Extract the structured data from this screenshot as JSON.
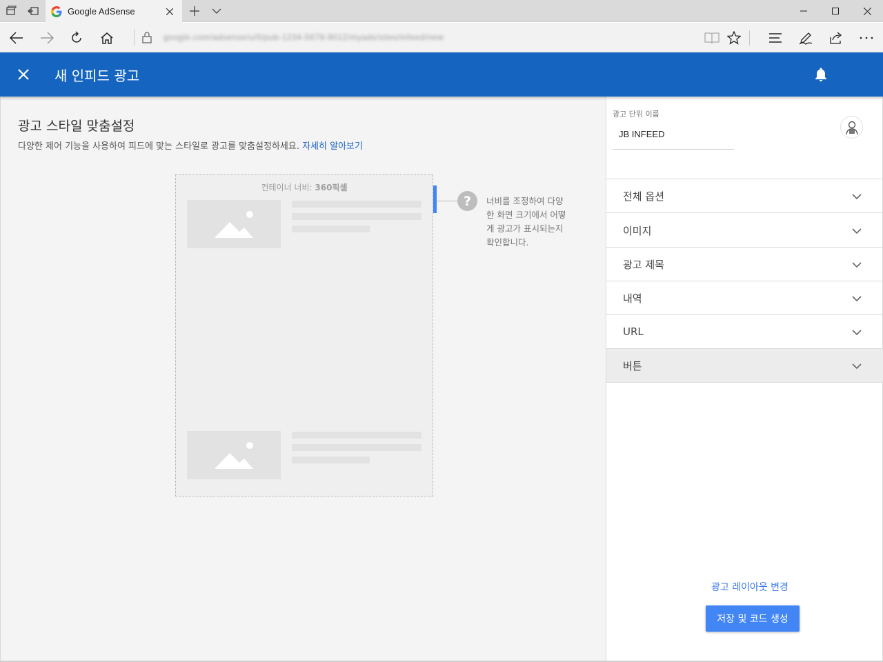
{
  "browser": {
    "tab_title": "Google AdSense",
    "url": "google.com/adsense/u/0/pub-1234-5678-9012/myads/sites/infeed/new"
  },
  "header": {
    "title": "새 인피드 광고"
  },
  "main": {
    "title": "광고 스타일 맞춤설정",
    "subtitle": "다양한 제어 기능을 사용하여 피드에 맞는 스타일로 광고를 맞춤설정하세요.",
    "learn_more": "자세히 알아보기",
    "container_width_label": "컨테이너 너비:",
    "container_width_value": "360픽셀",
    "help_icon_glyph": "?",
    "hint_text": "너비를 조정하여 다양한 화면 크기에서 어떻게 광고가 표시되는지 확인합니다."
  },
  "side": {
    "ad_unit_name_label": "광고 단위 이름",
    "ad_unit_name_value": "JB INFEED",
    "sections": [
      {
        "label": "전체 옵션"
      },
      {
        "label": "이미지"
      },
      {
        "label": "광고 제목"
      },
      {
        "label": "내역"
      },
      {
        "label": "URL"
      },
      {
        "label": "버튼"
      }
    ],
    "change_layout": "광고 레이아웃 변경",
    "save_button": "저장 및 코드 생성"
  },
  "colors": {
    "header_blue": "#1565c0",
    "accent_blue": "#4285f4",
    "link_blue": "#1a5fc5"
  }
}
